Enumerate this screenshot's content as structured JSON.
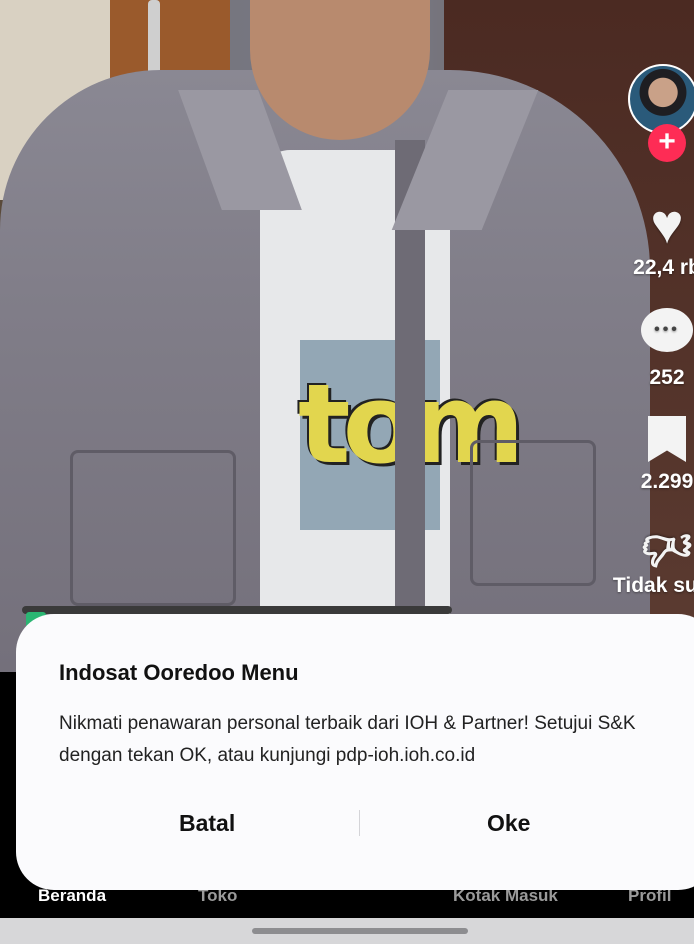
{
  "video": {
    "shirt_print": "tom"
  },
  "actions": {
    "likes": "22,4 rb",
    "comments": "252",
    "saves": "2.299",
    "dislike_label": "Tidak suka",
    "follow_symbol": "+"
  },
  "icons": {
    "heart": "heart-icon",
    "comment": "comment-icon",
    "bookmark": "bookmark-icon",
    "dislike": "dislike-icon"
  },
  "colors": {
    "follow": "#fe2c55",
    "dialog_bg": "#fbfbfd"
  },
  "bottom_nav": {
    "home": "Beranda",
    "shop": "Toko",
    "inbox": "Kotak Masuk",
    "profile": "Profil"
  },
  "dialog": {
    "title": "Indosat Ooredoo Menu",
    "body": "Nikmati penawaran personal terbaik dari IOH & Partner! Setujui S&K dengan tekan OK, atau kunjungi pdp-ioh.ioh.co.id",
    "cancel_label": "Batal",
    "ok_label": "Oke"
  }
}
